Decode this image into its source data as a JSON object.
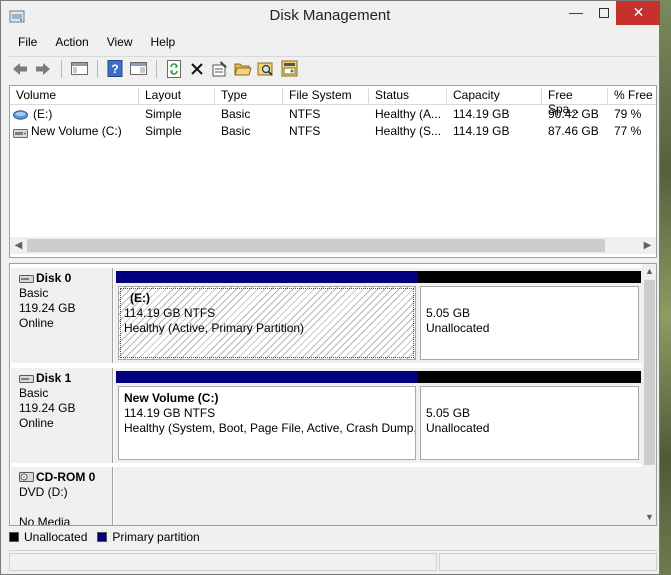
{
  "window": {
    "title": "Disk Management"
  },
  "menu": [
    "File",
    "Action",
    "View",
    "Help"
  ],
  "toolbar": [
    {
      "icon": "back-icon"
    },
    {
      "icon": "forward-icon"
    },
    {
      "icon": "console-tree-icon"
    },
    {
      "icon": "help-icon"
    },
    {
      "icon": "show-hide-icon"
    },
    {
      "icon": "refresh-icon"
    },
    {
      "icon": "delete-icon"
    },
    {
      "icon": "properties-icon"
    },
    {
      "icon": "open-icon"
    },
    {
      "icon": "explore-icon"
    },
    {
      "icon": "rescan-icon"
    }
  ],
  "volume_table": {
    "columns": [
      "Volume",
      "Layout",
      "Type",
      "File System",
      "Status",
      "Capacity",
      "Free Spa...",
      "% Free"
    ],
    "rows": [
      [
        "(E:)",
        "Simple",
        "Basic",
        "NTFS",
        "Healthy (A...",
        "114.19 GB",
        "90.42 GB",
        "79 %"
      ],
      [
        "New Volume (C:)",
        "Simple",
        "Basic",
        "NTFS",
        "Healthy (S...",
        "114.19 GB",
        "87.46 GB",
        "77 %"
      ]
    ]
  },
  "disks": [
    {
      "name": "Disk 0",
      "type": "Basic",
      "size": "119.24 GB",
      "state": "Online",
      "partitions": [
        {
          "name": "(E:)",
          "size_fs": "114.19 GB NTFS",
          "status": "Healthy (Active, Primary Partition)",
          "bar_color": "#00007f",
          "selected": true
        },
        {
          "name": "",
          "size_fs": "5.05 GB",
          "status": "Unallocated",
          "bar_color": "#000000",
          "selected": false
        }
      ]
    },
    {
      "name": "Disk 1",
      "type": "Basic",
      "size": "119.24 GB",
      "state": "Online",
      "partitions": [
        {
          "name": "New Volume  (C:)",
          "size_fs": "114.19 GB NTFS",
          "status": "Healthy (System, Boot, Page File, Active, Crash Dump,",
          "bar_color": "#00007f",
          "selected": false
        },
        {
          "name": "",
          "size_fs": "5.05 GB",
          "status": "Unallocated",
          "bar_color": "#000000",
          "selected": false
        }
      ]
    },
    {
      "name": "CD-ROM 0",
      "type": "DVD (D:)",
      "size": "",
      "state": "No Media",
      "partitions": []
    }
  ],
  "legend": [
    {
      "label": "Unallocated",
      "color": "#000000"
    },
    {
      "label": "Primary partition",
      "color": "#00007f"
    }
  ],
  "colors": {
    "primary": "#00007f",
    "unallocated": "#000000",
    "close_button": "#c7312b"
  }
}
